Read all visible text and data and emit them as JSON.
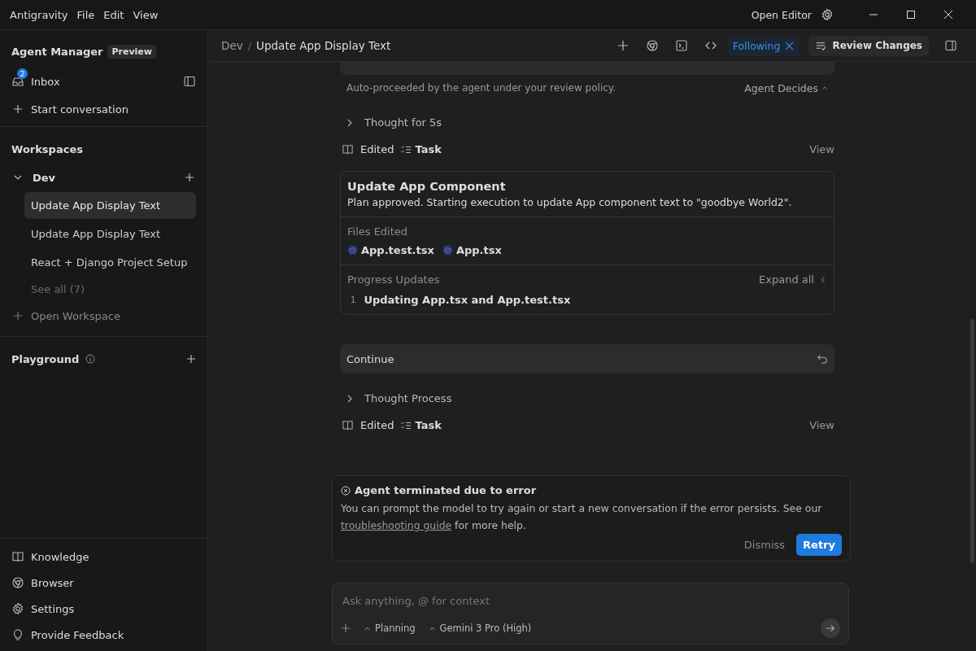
{
  "window": {
    "app_name": "Antigravity",
    "menu": [
      "File",
      "Edit",
      "View"
    ],
    "open_editor": "Open Editor"
  },
  "sidebar": {
    "title": "Agent Manager",
    "badge": "Preview",
    "inbox": {
      "label": "Inbox",
      "count": "2"
    },
    "start": "Start conversation",
    "workspaces_title": "Workspaces",
    "workspaces": [
      {
        "name": "Dev",
        "expanded": true,
        "conversations": [
          {
            "label": "Update App Display Text",
            "selected": true
          },
          {
            "label": "Update App Display Text",
            "selected": false
          },
          {
            "label": "React + Django Project Setup",
            "selected": false
          }
        ],
        "see_all": "See all (7)"
      }
    ],
    "open_workspace": "Open Workspace",
    "playground": "Playground",
    "footer": [
      {
        "kind": "book",
        "label": "Knowledge"
      },
      {
        "kind": "browser",
        "label": "Browser"
      },
      {
        "kind": "gear",
        "label": "Settings"
      },
      {
        "kind": "bulb",
        "label": "Provide Feedback"
      }
    ]
  },
  "header": {
    "breadcrumb": [
      "Dev",
      "Update App Display Text"
    ],
    "separator": "/",
    "following": "Following",
    "review": "Review Changes"
  },
  "feed": {
    "policy_note": "Auto-proceeded by the agent under your review policy.",
    "policy": "Agent Decides",
    "items": [
      {
        "kind": "thought",
        "label": "Thought for 5s"
      },
      {
        "kind": "edited",
        "label": "Edited",
        "target": "Task",
        "action": "View"
      },
      {
        "kind": "task_card",
        "title": "Update App Component",
        "summary": "Plan approved. Starting execution to update App component text to \"goodbye World2\".",
        "files_label": "Files Edited",
        "files": [
          "App.test.tsx",
          "App.tsx"
        ],
        "progress_label": "Progress Updates",
        "expand": "Expand all",
        "updates": [
          {
            "number": "1",
            "text": "Updating App.tsx and App.test.tsx"
          }
        ]
      },
      {
        "kind": "continue",
        "label": "Continue"
      },
      {
        "kind": "thought",
        "label": "Thought Process"
      },
      {
        "kind": "edited",
        "label": "Edited",
        "target": "Task",
        "action": "View"
      }
    ]
  },
  "error_popup": {
    "title": "Agent terminated due to error",
    "text": "You can prompt the model to try again or start a new conversation if the error persists. See our",
    "link": "troubleshooting guide",
    "text_after": "for more help.",
    "dismiss": "Dismiss",
    "retry": "Retry"
  },
  "composer": {
    "placeholder": "Ask anything, @ for context",
    "mode": "Planning",
    "model": "Gemini 3 Pro (High)"
  }
}
